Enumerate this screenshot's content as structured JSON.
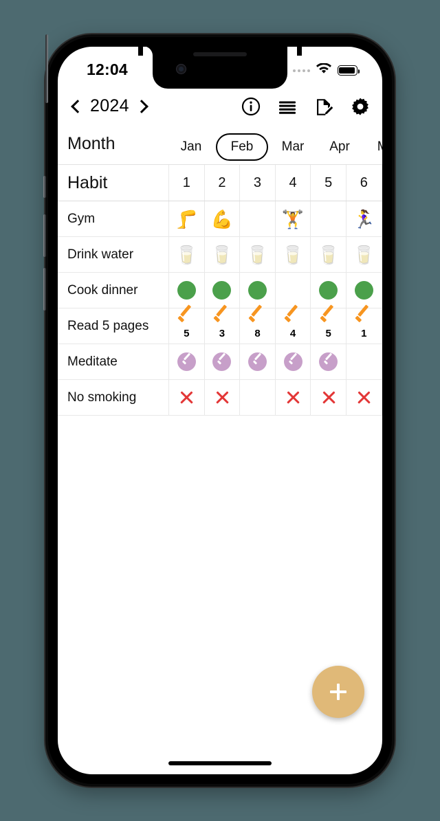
{
  "device": {
    "status_bar": {
      "time": "12:04",
      "signal_icon": "signal-dots-icon",
      "wifi_icon": "wifi-icon",
      "battery_icon": "battery-full-icon"
    },
    "home_indicator": "home-indicator"
  },
  "header": {
    "prev_icon": "chevron-left-icon",
    "year": "2024",
    "next_icon": "chevron-right-icon",
    "toolbar": [
      {
        "name": "info-icon",
        "label": "Info"
      },
      {
        "name": "menu-icon",
        "label": "Menu"
      },
      {
        "name": "edit-document-icon",
        "label": "Edit"
      },
      {
        "name": "gear-icon",
        "label": "Settings"
      }
    ]
  },
  "month_strip": {
    "label": "Month",
    "selected": "Feb",
    "tabs": [
      "Jan",
      "Feb",
      "Mar",
      "Apr",
      "Ma"
    ]
  },
  "table": {
    "header": {
      "habit_label": "Habit",
      "days": [
        "1",
        "2",
        "3",
        "4",
        "5",
        "6"
      ]
    },
    "rows": [
      {
        "habit": "Gym",
        "type": "emoji",
        "cells": [
          "🦵",
          "💪",
          "",
          "🏋️",
          "",
          "🏃‍♀️"
        ]
      },
      {
        "habit": "Drink water",
        "type": "emoji",
        "cells": [
          "🥛",
          "🥛",
          "🥛",
          "🥛",
          "🥛",
          "🥛"
        ]
      },
      {
        "habit": "Cook dinner",
        "type": "dot-green",
        "cells": [
          "1",
          "1",
          "1",
          "",
          "1",
          "1"
        ]
      },
      {
        "habit": "Read 5 pages",
        "type": "check-count",
        "cells": [
          "5",
          "3",
          "8",
          "4",
          "5",
          "1"
        ]
      },
      {
        "habit": "Meditate",
        "type": "circle-check",
        "cells": [
          "1",
          "1",
          "1",
          "1",
          "1",
          ""
        ]
      },
      {
        "habit": "No smoking",
        "type": "x-red",
        "cells": [
          "1",
          "1",
          "",
          "1",
          "1",
          "1"
        ]
      }
    ]
  },
  "fab": {
    "label": "+",
    "name": "add-habit-button"
  },
  "colors": {
    "background": "#4d6a70",
    "accent_fab": "#e0b978",
    "green": "#4ba04b",
    "orange": "#f79520",
    "purple": "#c79fc9",
    "red": "#e33636"
  }
}
